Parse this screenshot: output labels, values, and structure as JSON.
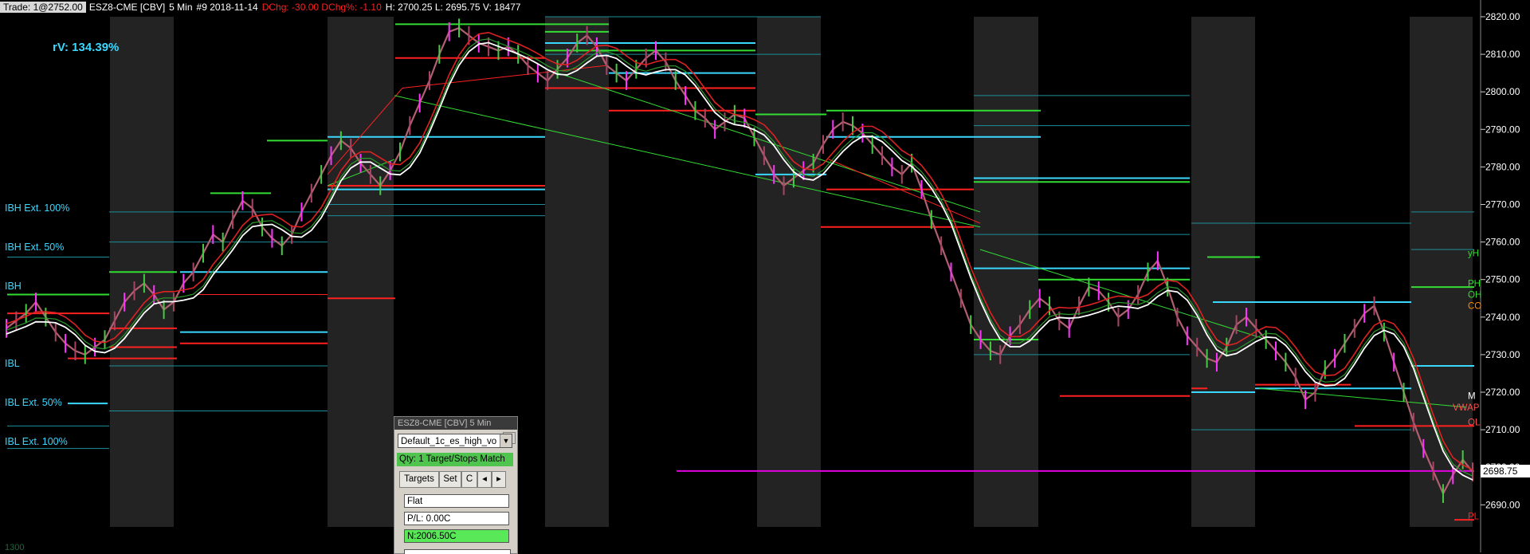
{
  "header": {
    "trade_box": "Trade: 1@2752.00",
    "symbol": "ESZ8-CME [CBV]",
    "interval": "5 Min",
    "bar_info": "#9 2018-11-14",
    "dchg": "DChg: -30.00 DChg%: -1.10",
    "ohlc": "H: 2700.25 L: 2695.75 V: 18477"
  },
  "rv_label": "rV: 134.39%",
  "level_labels": {
    "ibh_ext_100": "IBH Ext. 100%",
    "ibh_ext_50": "IBH Ext. 50%",
    "ibh": "IBH",
    "ibl": "IBL",
    "ibl_ext_50": "IBL Ext. 50%",
    "ibl_ext_100": "IBL Ext. 100%"
  },
  "bottom_left_label": "1300",
  "price_axis": {
    "ticks": [
      "2820.00",
      "2810.00",
      "2800.00",
      "2790.00",
      "2780.00",
      "2770.00",
      "2760.00",
      "2750.00",
      "2740.00",
      "2730.00",
      "2720.00",
      "2710.00",
      "2700.00",
      "2690.00"
    ],
    "current_price": "2698.75"
  },
  "right_markers": [
    "yH",
    "PH",
    "OH",
    "CO",
    "M",
    "VWAP",
    "OL",
    "PL"
  ],
  "trade_window": {
    "title": "ESZ8-CME [CBV]  5 Min",
    "close": "✕",
    "profile": "Default_1c_es_high_vo",
    "qty": "Qty: 1 Target/Stops Match",
    "tabs": [
      "Targets",
      "Set",
      "C",
      "◂",
      "▸"
    ],
    "position": "Flat",
    "pnl": "P/L: 0.00C",
    "balance": "N:2006.50C"
  },
  "chart_data": {
    "type": "line",
    "title": "",
    "xlabel": "",
    "ylabel": "",
    "ylim": [
      2684,
      2823
    ],
    "series": [
      {
        "values": [
          2737,
          2739,
          2741,
          2744,
          2740,
          2736,
          2733,
          2731,
          2730,
          2732,
          2734,
          2739,
          2744,
          2747,
          2749,
          2746,
          2742,
          2744,
          2749,
          2752,
          2757,
          2762,
          2760,
          2766,
          2771,
          2769,
          2764,
          2761,
          2759,
          2762,
          2768,
          2773,
          2778,
          2783,
          2787,
          2785,
          2781,
          2778,
          2775,
          2779,
          2784,
          2791,
          2797,
          2803,
          2810,
          2816,
          2817,
          2815,
          2813,
          2812,
          2811,
          2812,
          2810,
          2807,
          2805,
          2803,
          2806,
          2809,
          2813,
          2815,
          2812,
          2807,
          2805,
          2803,
          2806,
          2809,
          2811,
          2808,
          2803,
          2799,
          2795,
          2793,
          2790,
          2792,
          2794,
          2793,
          2788,
          2783,
          2778,
          2775,
          2777,
          2779,
          2781,
          2786,
          2790,
          2792,
          2791,
          2789,
          2786,
          2783,
          2780,
          2778,
          2781,
          2774,
          2766,
          2759,
          2752,
          2745,
          2738,
          2734,
          2731,
          2730,
          2735,
          2738,
          2742,
          2745,
          2743,
          2739,
          2737,
          2743,
          2748,
          2747,
          2744,
          2740,
          2742,
          2746,
          2752,
          2755,
          2748,
          2740,
          2735,
          2732,
          2729,
          2728,
          2732,
          2738,
          2740,
          2737,
          2734,
          2731,
          2728,
          2724,
          2718,
          2720,
          2726,
          2729,
          2733,
          2737,
          2741,
          2743,
          2736,
          2728,
          2720,
          2712,
          2705,
          2699,
          2693,
          2698,
          2702,
          2698.75
        ]
      }
    ]
  }
}
